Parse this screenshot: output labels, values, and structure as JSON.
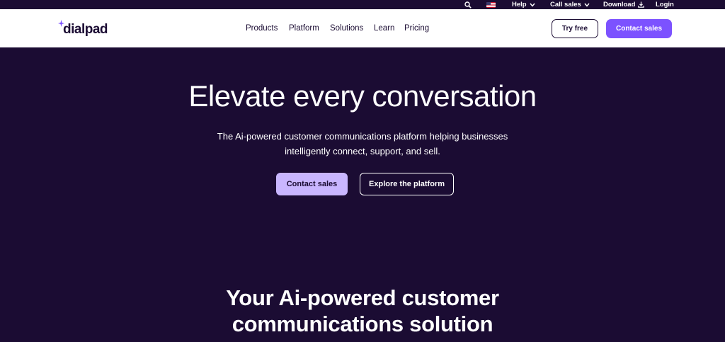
{
  "utility": {
    "search_icon": "search-icon",
    "flag_icon": "us-flag-icon",
    "help": "Help",
    "call_sales": "Call sales",
    "download": "Download",
    "login": "Login"
  },
  "header": {
    "logo_text": "dialpad",
    "nav": [
      "Products",
      "Platform",
      "Solutions",
      "Learn",
      "Pricing"
    ],
    "try_free": "Try free",
    "contact_sales": "Contact sales"
  },
  "hero": {
    "title": "Elevate every conversation",
    "subtitle_line1": "The Ai-powered customer communications platform helping businesses",
    "subtitle_line2": "intelligently connect, support, and sell.",
    "primary_button": "Contact sales",
    "secondary_button": "Explore the platform"
  },
  "section": {
    "title_line1": "Your Ai-powered customer",
    "title_line2": "communications solution"
  },
  "colors": {
    "background": "#1b0c33",
    "accent": "#7c52ff",
    "accent_light": "#c9b6ff",
    "white": "#ffffff"
  }
}
